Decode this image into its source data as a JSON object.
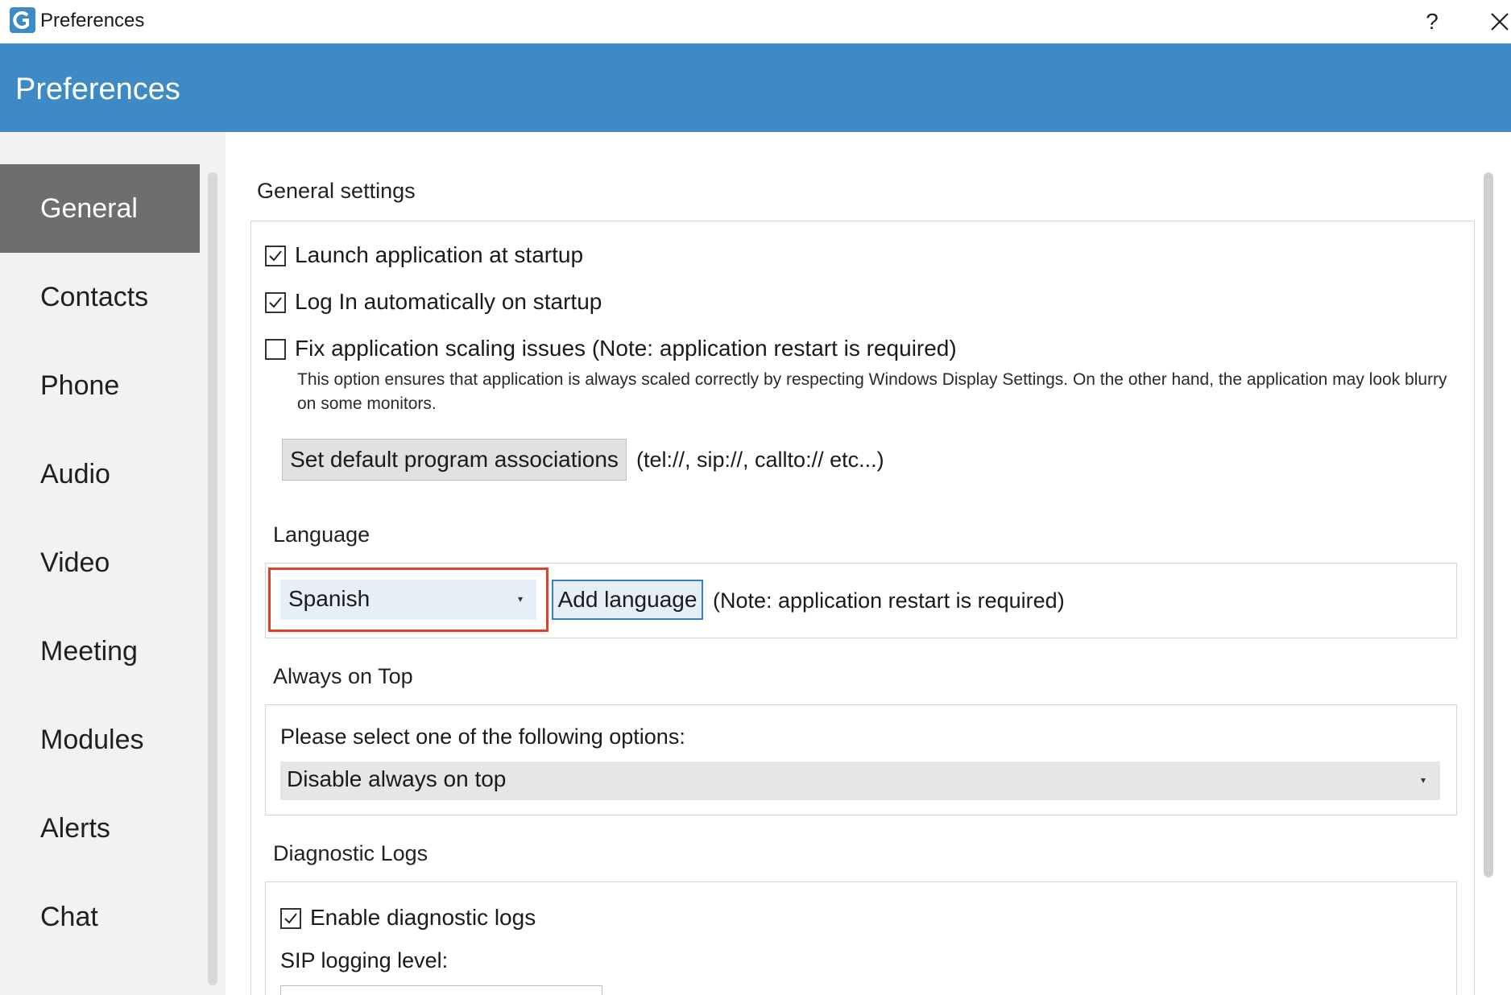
{
  "window": {
    "title": "Preferences",
    "help_glyph": "?"
  },
  "header": {
    "title": "Preferences"
  },
  "sidebar": {
    "items": [
      {
        "label": "General",
        "active": true
      },
      {
        "label": "Contacts",
        "active": false
      },
      {
        "label": "Phone",
        "active": false
      },
      {
        "label": "Audio",
        "active": false
      },
      {
        "label": "Video",
        "active": false
      },
      {
        "label": "Meeting",
        "active": false
      },
      {
        "label": "Modules",
        "active": false
      },
      {
        "label": "Alerts",
        "active": false
      },
      {
        "label": "Chat",
        "active": false
      }
    ]
  },
  "general": {
    "section_title": "General settings",
    "launch_startup": {
      "label": "Launch application at startup",
      "checked": true
    },
    "login_auto": {
      "label": "Log In automatically on startup",
      "checked": true
    },
    "fix_scaling": {
      "label": "Fix application scaling issues (Note: application restart is required)",
      "checked": false
    },
    "scaling_desc": "This option ensures that application is always scaled correctly by respecting Windows Display Settings. On the other hand, the application may look blurry on some monitors.",
    "assoc_button": "Set default program associations",
    "assoc_note": "(tel://, sip://, callto:// etc...)"
  },
  "language": {
    "section_title": "Language",
    "selected": "Spanish",
    "add_button": "Add language",
    "note": "(Note: application restart is required)"
  },
  "always_on_top": {
    "section_title": "Always on Top",
    "prompt": "Please select one of the following options:",
    "selected": "Disable always on top"
  },
  "diagnostic": {
    "section_title": "Diagnostic Logs",
    "enable": {
      "label": "Enable diagnostic logs",
      "checked": true
    },
    "sip_level_label": "SIP logging level:"
  },
  "colors": {
    "accent": "#3d8ac5",
    "sidebar_active": "#6e6e6e",
    "highlight": "#e0412b"
  }
}
